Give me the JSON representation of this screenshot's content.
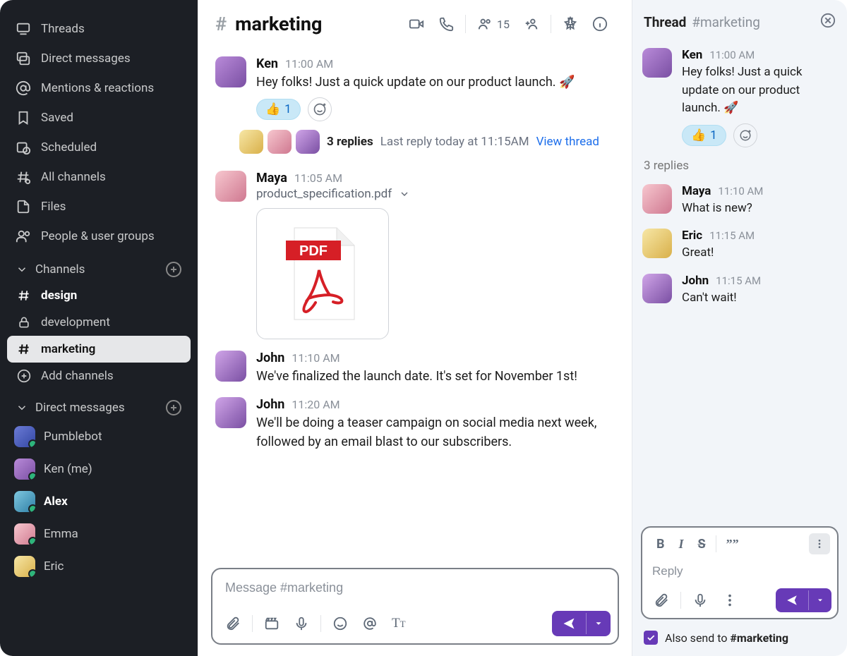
{
  "sidebar": {
    "nav": [
      {
        "label": "Threads"
      },
      {
        "label": "Direct messages"
      },
      {
        "label": "Mentions & reactions"
      },
      {
        "label": "Saved"
      },
      {
        "label": "Scheduled"
      },
      {
        "label": "All channels"
      },
      {
        "label": "Files"
      },
      {
        "label": "People & user groups"
      }
    ],
    "channels_header": "Channels",
    "channels": [
      {
        "label": "design"
      },
      {
        "label": "development"
      },
      {
        "label": "marketing"
      }
    ],
    "add_channels": "Add channels",
    "dm_header": "Direct messages",
    "dms": [
      {
        "label": "Pumblebot"
      },
      {
        "label": "Ken (me)"
      },
      {
        "label": "Alex"
      },
      {
        "label": "Emma"
      },
      {
        "label": "Eric"
      }
    ]
  },
  "header": {
    "channel": "marketing",
    "member_count": "15"
  },
  "messages": [
    {
      "author": "Ken",
      "time": "11:00 AM",
      "text": "Hey folks! Just a quick update on our product launch. 🚀"
    },
    {
      "author": "Maya",
      "time": "11:05 AM",
      "file": "product_specification.pdf"
    },
    {
      "author": "John",
      "time": "11:10 AM",
      "text": "We've finalized the launch date. It's set for November 1st!"
    },
    {
      "author": "John",
      "time": "11:20 AM",
      "text": "We'll be doing a teaser campaign on social media next week, followed by an email blast to our subscribers."
    }
  ],
  "reaction": {
    "emoji": "👍",
    "count": "1"
  },
  "thread_summary": {
    "count": "3 replies",
    "last": "Last reply today at 11:15AM",
    "link": "View thread"
  },
  "composer": {
    "placeholder": "Message #marketing"
  },
  "thread": {
    "title": "Thread",
    "subtitle": "#marketing",
    "root": {
      "author": "Ken",
      "time": "11:00 AM",
      "text": "Hey folks! Just a quick update on our product launch. 🚀"
    },
    "replies_label": "3 replies",
    "replies": [
      {
        "author": "Maya",
        "time": "11:10 AM",
        "text": "What is new?"
      },
      {
        "author": "Eric",
        "time": "11:15 AM",
        "text": "Great!"
      },
      {
        "author": "John",
        "time": "11:15 AM",
        "text": "Can't wait!"
      }
    ],
    "reply_placeholder": "Reply",
    "also_send_prefix": "Also send to ",
    "also_send_channel": "#marketing"
  }
}
